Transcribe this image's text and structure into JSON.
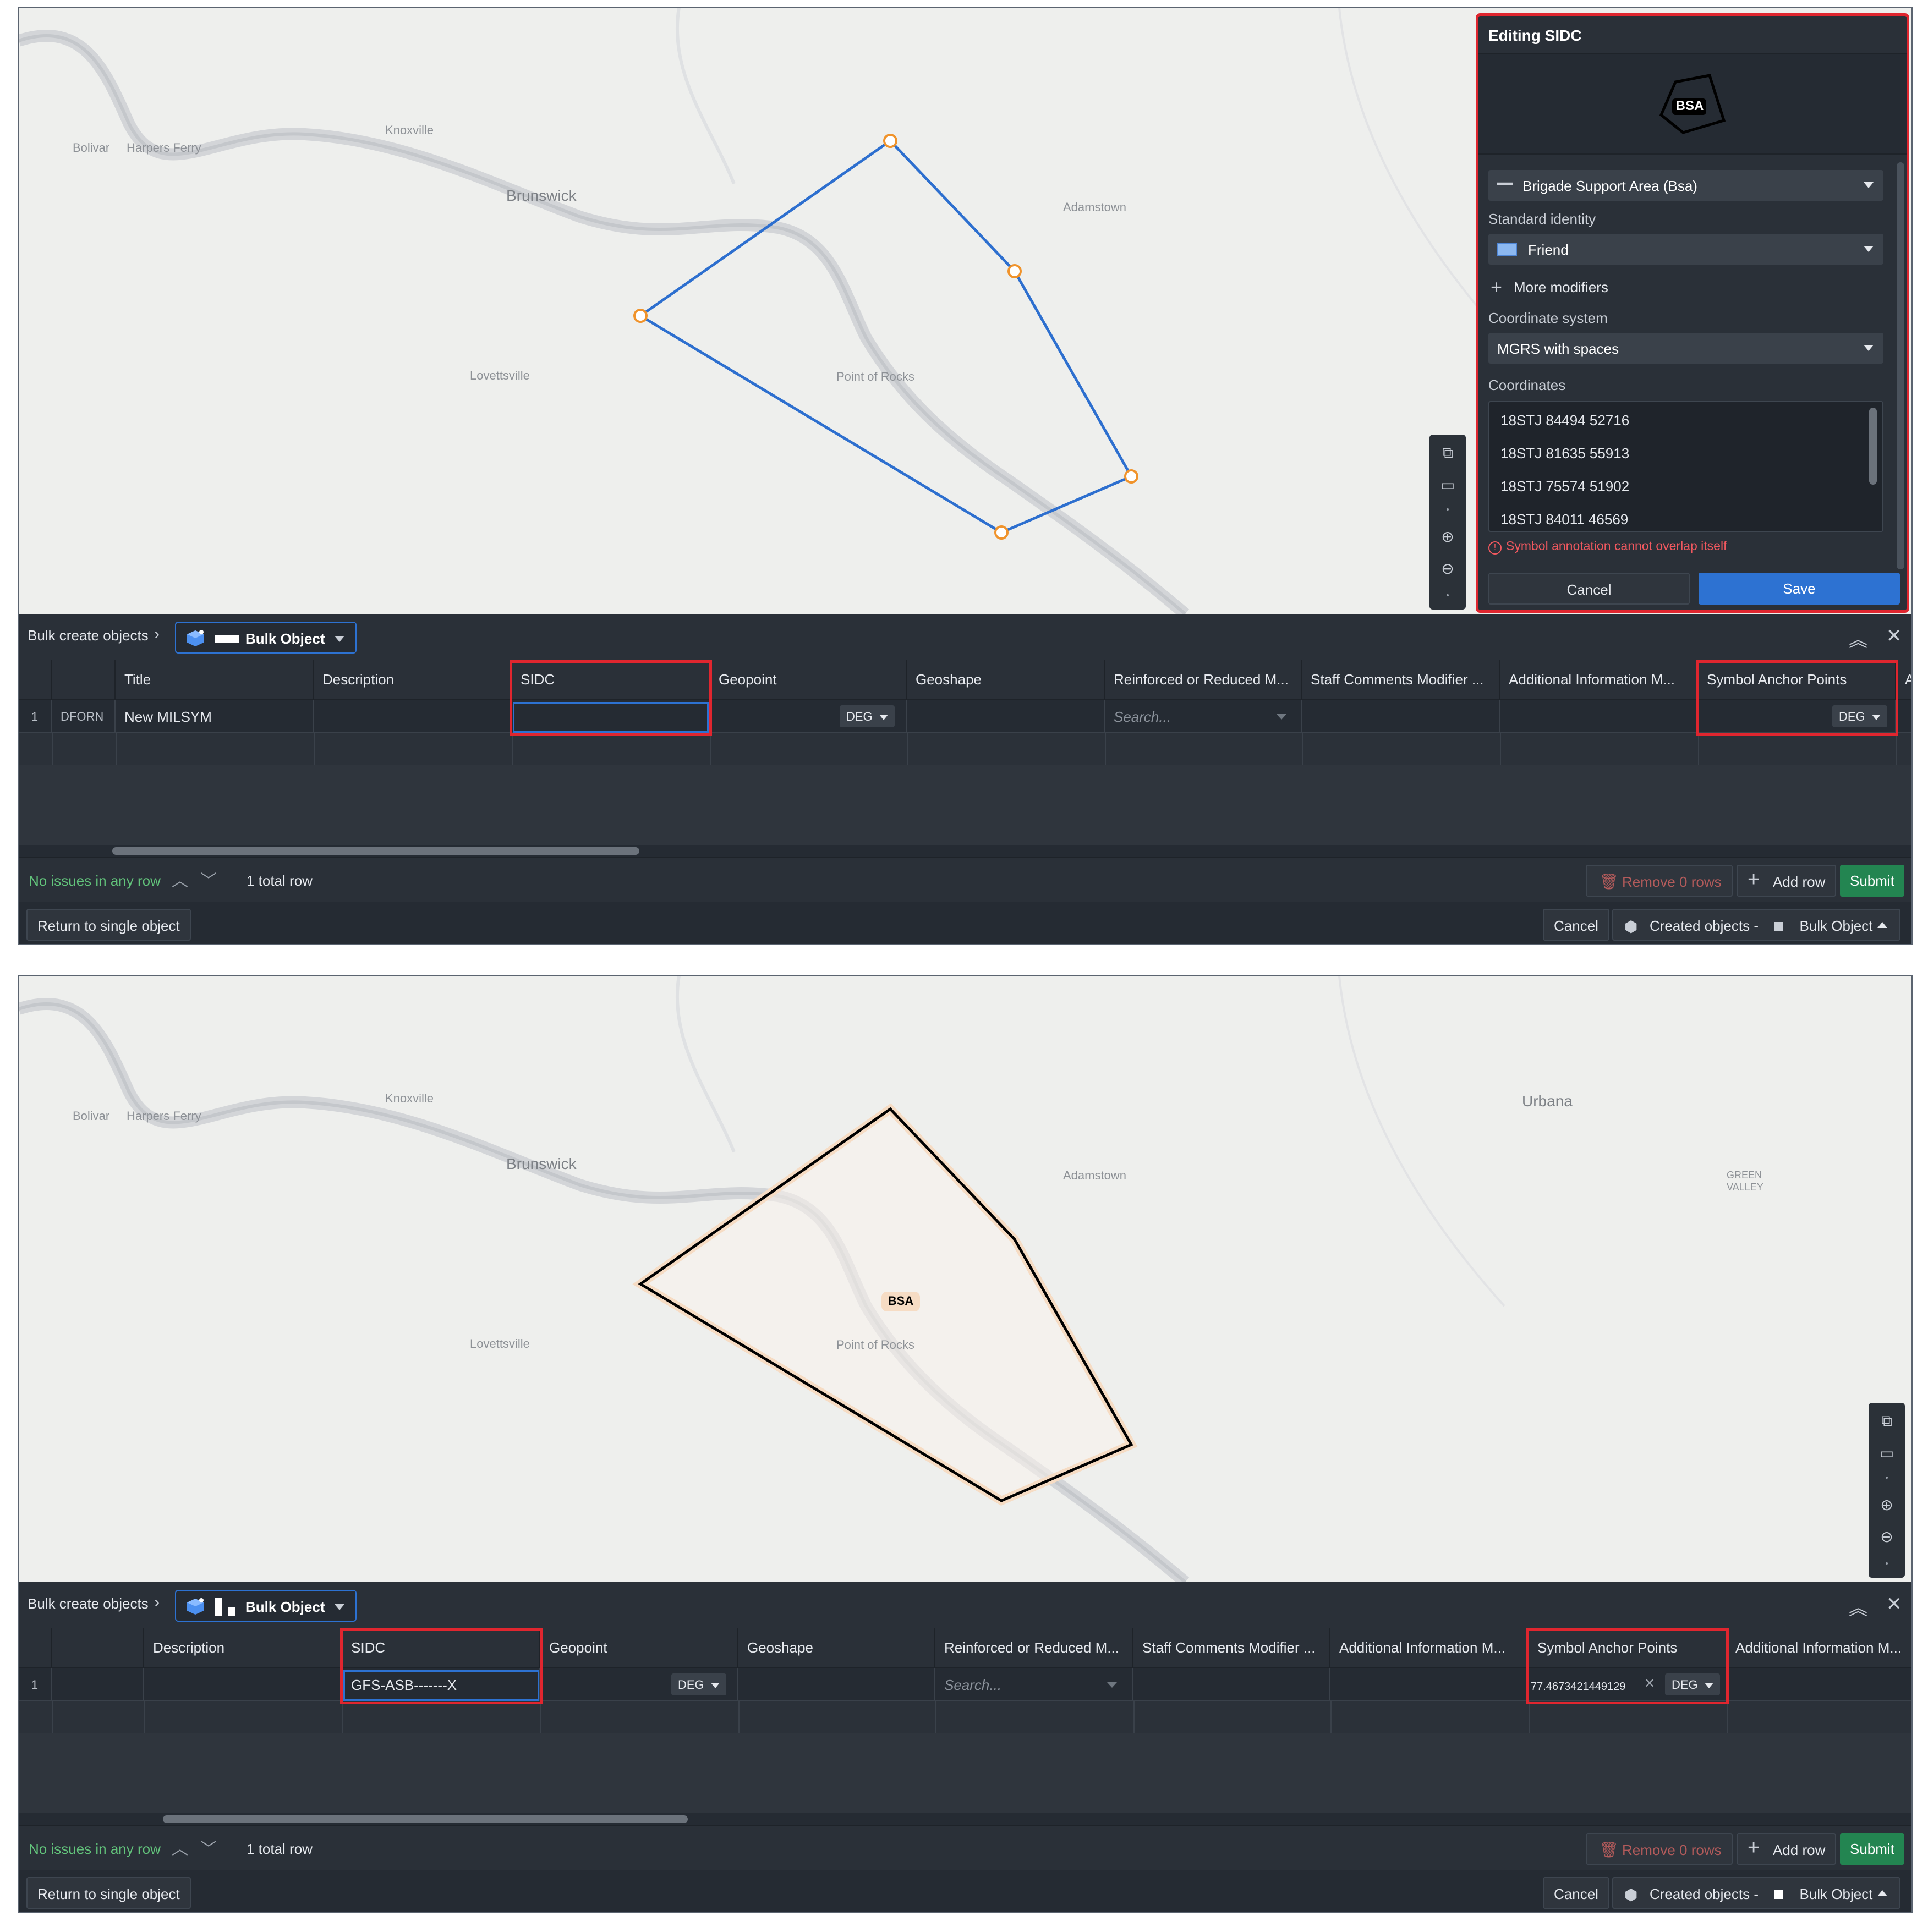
{
  "map_labels": {
    "knoxville": "Knoxville",
    "bolivar": "Bolivar",
    "harpers_ferry": "Harpers Ferry",
    "brunswick": "Brunswick",
    "adamstown": "Adamstown",
    "lovettsville": "Lovettsville",
    "point_of_rocks": "Point of Rocks",
    "urbana": "Urbana",
    "green_valley_1": "GREEN",
    "green_valley_2": "VALLEY"
  },
  "symbol_label": "BSA",
  "editor": {
    "title": "Editing SIDC",
    "symbol_text": "BSA",
    "symbol_type": "Brigade Support Area (Bsa)",
    "standard_identity_label": "Standard identity",
    "standard_identity": "Friend",
    "friend_color": "#8cb8f0",
    "more_modifiers": "More modifiers",
    "coordinate_system_label": "Coordinate system",
    "coordinate_system": "MGRS with spaces",
    "coordinates_label": "Coordinates",
    "coordinates": [
      "18STJ 84494 52716",
      "18STJ 81635 55913",
      "18STJ 75574 51902",
      "18STJ 84011 46569"
    ],
    "error": "Symbol annotation cannot overlap itself",
    "cancel": "Cancel",
    "save": "Save"
  },
  "bulk": {
    "breadcrumb": "Bulk create objects",
    "object_type": "Bulk Object",
    "status_ok": "No issues in any row",
    "total_rows": "1 total row",
    "remove_rows": "Remove 0 rows",
    "add_row": "Add row",
    "submit": "Submit",
    "return_single": "Return to single object",
    "cancel": "Cancel",
    "created_objects": "Created objects -",
    "created_type": "Bulk Object",
    "deg": "DEG",
    "search_placeholder": "Search..."
  },
  "table_a": {
    "headers": [
      "Title",
      "Description",
      "SIDC",
      "Geopoint",
      "Geoshape",
      "Reinforced or Reduced M...",
      "Staff Comments Modifier ...",
      "Additional Information M...",
      "Symbol Anchor Points",
      "Ac"
    ],
    "row_num": "1",
    "row_id": "DFORN",
    "title": "New MILSYM",
    "sidc": ""
  },
  "table_b": {
    "headers": [
      "Description",
      "SIDC",
      "Geopoint",
      "Geoshape",
      "Reinforced or Reduced M...",
      "Staff Comments Modifier ...",
      "Additional Information M...",
      "Symbol Anchor Points",
      "Additional Information M..."
    ],
    "row_num": "1",
    "sidc": "GFS-ASB-------X",
    "anchor": "77.4673421449129"
  },
  "colors": {
    "accent": "#2d72d2",
    "highlight": "#e0262f",
    "success": "#238551",
    "polygon_edit": "#2d6fcf",
    "vertex": "#f0932b"
  }
}
